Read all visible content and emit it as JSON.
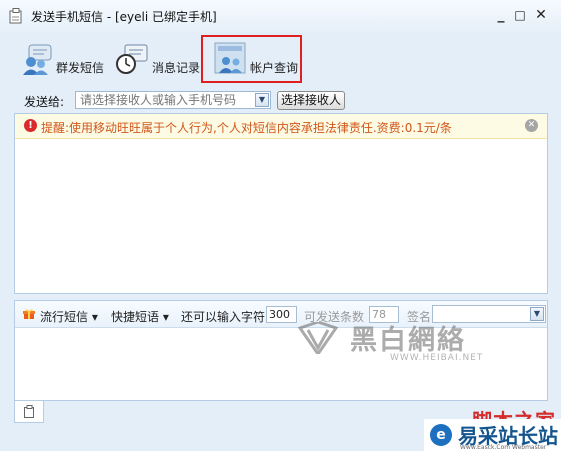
{
  "window": {
    "title": "发送手机短信 - [eyeli 已绑定手机]",
    "minimize": "_",
    "maximize": "□",
    "close": "✕"
  },
  "toolbar": {
    "items": [
      {
        "label": "群发短信",
        "icon": "group-sms-icon"
      },
      {
        "label": "消息记录",
        "icon": "message-history-icon"
      },
      {
        "label": "帐户查询",
        "icon": "account-query-icon"
      }
    ],
    "highlight_color": "#e02020"
  },
  "recipient": {
    "label": "发送给:",
    "placeholder": "请选择接收人或输入手机号码",
    "choose_button": "选择接收人"
  },
  "warning": {
    "text": "提醒:使用移动旺旺属于个人行为,个人对短信内容承担法律责任.资费:0.1元/条",
    "color": "#d0561a"
  },
  "compose_bar": {
    "popular": "流行短信",
    "quick": "快捷短语",
    "chars_label": "还可以输入字符",
    "chars_value": "300",
    "count_label": "可发送条数",
    "count_value": "78",
    "sign_label": "签名"
  },
  "watermarks": {
    "heibai": "黑白網絡",
    "heibai_url": "WWW.HEIBAI.NET",
    "jiaoben": "脚本之家",
    "brand": "易采站长站",
    "brand_url": "Www.Easck.Com Webmaster"
  }
}
